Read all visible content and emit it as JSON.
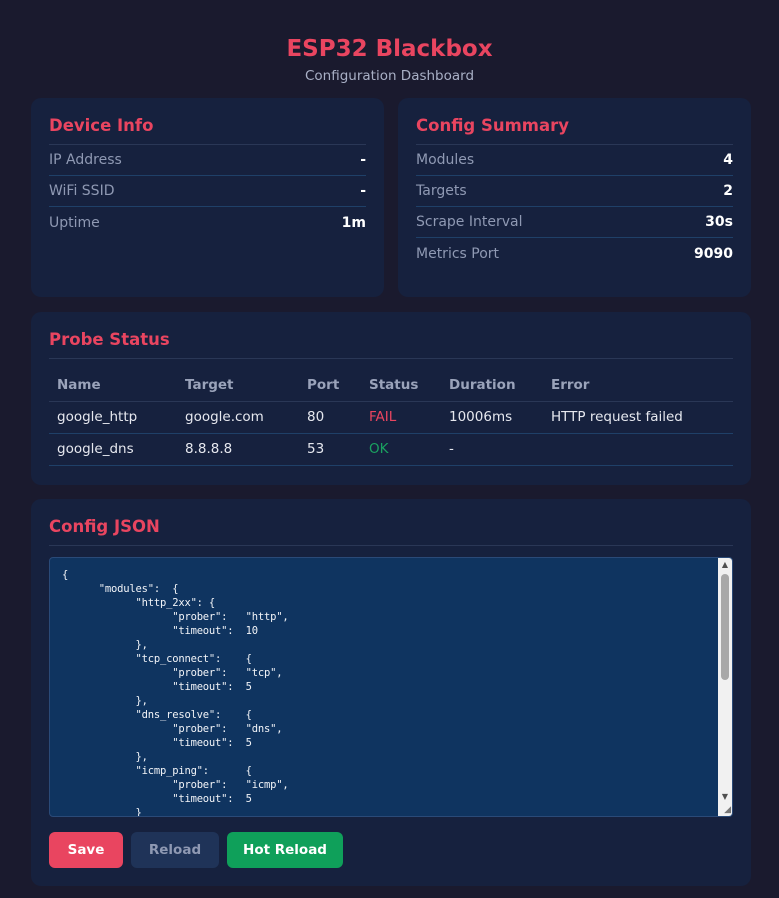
{
  "header": {
    "title": "ESP32 Blackbox",
    "subtitle": "Configuration Dashboard"
  },
  "device_info": {
    "title": "Device Info",
    "rows": [
      {
        "label": "IP Address",
        "value": "-"
      },
      {
        "label": "WiFi SSID",
        "value": "-"
      },
      {
        "label": "Uptime",
        "value": "1m"
      }
    ]
  },
  "config_summary": {
    "title": "Config Summary",
    "rows": [
      {
        "label": "Modules",
        "value": "4"
      },
      {
        "label": "Targets",
        "value": "2"
      },
      {
        "label": "Scrape Interval",
        "value": "30s"
      },
      {
        "label": "Metrics Port",
        "value": "9090"
      }
    ]
  },
  "probe_status": {
    "title": "Probe Status",
    "columns": [
      "Name",
      "Target",
      "Port",
      "Status",
      "Duration",
      "Error"
    ],
    "rows": [
      {
        "name": "google_http",
        "target": "google.com",
        "port": "80",
        "status": "FAIL",
        "duration": "10006ms",
        "error": "HTTP request failed"
      },
      {
        "name": "google_dns",
        "target": "8.8.8.8",
        "port": "53",
        "status": "OK",
        "duration": "-",
        "error": ""
      }
    ]
  },
  "config_json": {
    "title": "Config JSON",
    "content": "{\n\t\"modules\":\t{\n\t\t\"http_2xx\":\t{\n\t\t\t\"prober\":\t\"http\",\n\t\t\t\"timeout\":\t10\n\t\t},\n\t\t\"tcp_connect\":\t{\n\t\t\t\"prober\":\t\"tcp\",\n\t\t\t\"timeout\":\t5\n\t\t},\n\t\t\"dns_resolve\":\t{\n\t\t\t\"prober\":\t\"dns\",\n\t\t\t\"timeout\":\t5\n\t\t},\n\t\t\"icmp_ping\":\t{\n\t\t\t\"prober\":\t\"icmp\",\n\t\t\t\"timeout\":\t5\n\t\t}"
  },
  "buttons": {
    "save": "Save",
    "reload": "Reload",
    "hot_reload": "Hot Reload"
  },
  "colors": {
    "accent": "#e94560",
    "ok": "#1aa260",
    "background": "#1a1a2e",
    "card": "#16213e"
  }
}
